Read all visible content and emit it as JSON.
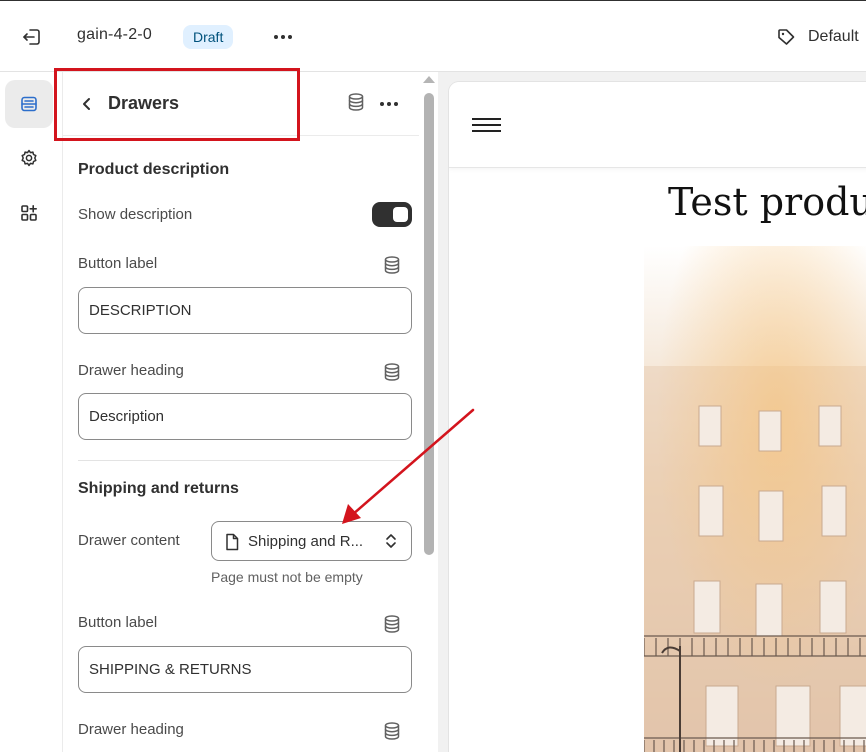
{
  "topbar": {
    "exit_icon": "exit-icon",
    "theme_name": "gain-4-2-0",
    "status_badge": "Draft",
    "more_icon": "more-horizontal-icon",
    "template_icon": "tag-icon",
    "template_label": "Default"
  },
  "rail": {
    "items": [
      {
        "icon": "sections-icon",
        "active": true
      },
      {
        "icon": "gear-icon",
        "active": false
      },
      {
        "icon": "apps-add-icon",
        "active": false
      }
    ]
  },
  "panel": {
    "back_icon": "chevron-left-icon",
    "title": "Drawers",
    "header_icons": [
      "database-icon",
      "more-horizontal-icon"
    ],
    "product_description": {
      "title": "Product description",
      "show_description_label": "Show description",
      "show_description": true,
      "button_label_label": "Button label",
      "button_label_value": "DESCRIPTION",
      "drawer_heading_label": "Drawer heading",
      "drawer_heading_value": "Description"
    },
    "shipping_returns": {
      "title": "Shipping and returns",
      "drawer_content_label": "Drawer content",
      "drawer_content_value": "Shipping and R...",
      "drawer_content_help": "Page must not be empty",
      "button_label_label": "Button label",
      "button_label_value": "SHIPPING & RETURNS",
      "drawer_heading_label": "Drawer heading"
    }
  },
  "preview": {
    "menu_icon": "hamburger-menu-icon",
    "product_title": "Test produ"
  },
  "colors": {
    "accent_red": "#d3141d",
    "draft_bg": "#e0f0ff",
    "draft_text": "#00527c",
    "toggle_on": "#303030"
  }
}
